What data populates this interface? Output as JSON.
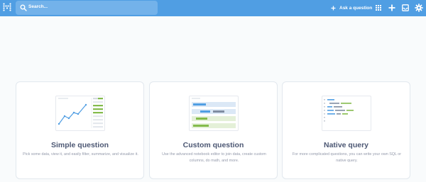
{
  "header": {
    "search_placeholder": "Search...",
    "ask_label": "Ask a question"
  },
  "icons": {
    "logo": "metabase-logo-icon",
    "search": "search-icon",
    "ask": "plus-icon",
    "browse": "grid-icon",
    "new": "plus-icon",
    "activity": "inbox-icon",
    "settings": "gear-icon"
  },
  "colors": {
    "brand": "#509ee3",
    "card_title": "#4c5773",
    "card_text": "#949aab",
    "accent_green": "#84bb4c"
  },
  "cards": [
    {
      "title": "Simple question",
      "description": "Pick some data, view it, and easily filter, summarize, and visualize it."
    },
    {
      "title": "Custom question",
      "description": "Use the advanced notebook editor to join data, create custom columns, do math, and more."
    },
    {
      "title": "Native query",
      "description": "For more complicated questions, you can write your own SQL or native query."
    }
  ]
}
